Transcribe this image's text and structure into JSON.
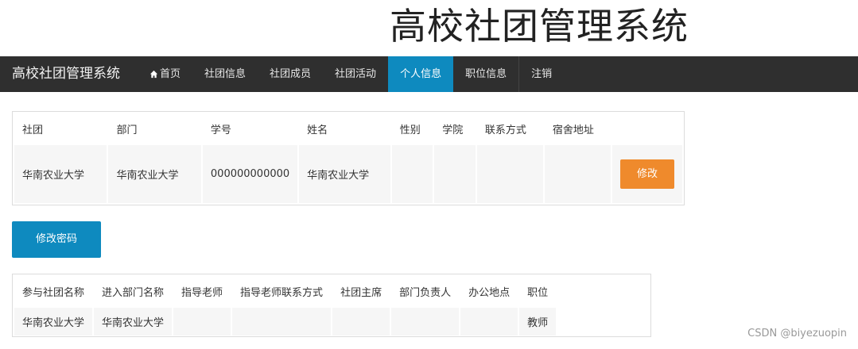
{
  "header": {
    "title": "高校社团管理系统"
  },
  "navbar": {
    "brand": "高校社团管理系统",
    "items": [
      {
        "label": "首页",
        "icon": "home-icon",
        "active": false
      },
      {
        "label": "社团信息",
        "active": false
      },
      {
        "label": "社团成员",
        "active": false
      },
      {
        "label": "社团活动",
        "active": false
      },
      {
        "label": "个人信息",
        "active": true
      },
      {
        "label": "职位信息",
        "active": false
      },
      {
        "label": "注销",
        "active": false
      }
    ]
  },
  "profile_table": {
    "headers": [
      "社团",
      "部门",
      "学号",
      "姓名",
      "性别",
      "学院",
      "联系方式",
      "宿舍地址",
      ""
    ],
    "row": {
      "club": "华南农业大学",
      "department": "华南农业大学",
      "student_id": "000000000000",
      "name": "华南农业大学",
      "gender": "",
      "college": "",
      "contact": "",
      "dorm": "",
      "edit_label": "修改"
    }
  },
  "change_password_label": "修改密码",
  "membership_table": {
    "headers": [
      "参与社团名称",
      "进入部门名称",
      "指导老师",
      "指导老师联系方式",
      "社团主席",
      "部门负责人",
      "办公地点",
      "职位"
    ],
    "row": [
      "华南农业大学",
      "华南农业大学",
      "",
      "",
      "",
      "",
      "",
      "教师"
    ]
  },
  "watermark": "CSDN @biyezuopin",
  "colors": {
    "navbar": "#2f2f2f",
    "active": "#0e8abf",
    "edit_button": "#ef8a2c"
  }
}
